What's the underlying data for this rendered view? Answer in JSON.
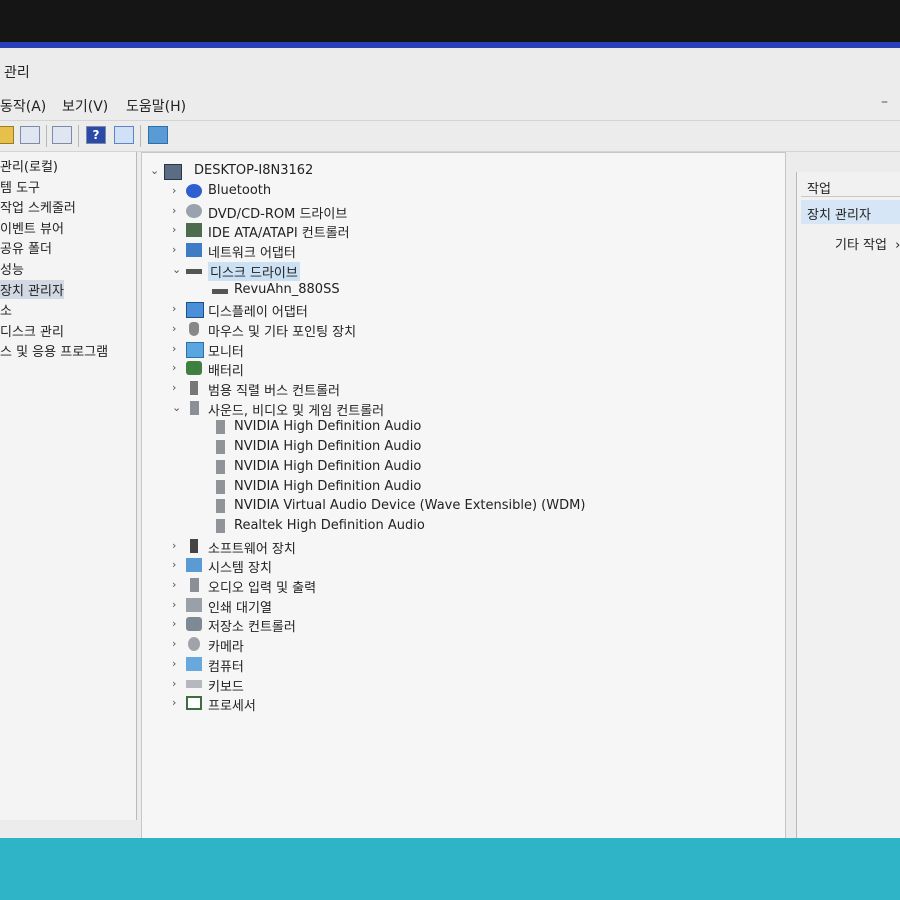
{
  "window": {
    "title": "관리"
  },
  "menu": {
    "items": [
      "동작(A)",
      "보기(V)",
      "도움말(H)"
    ],
    "minimize": "–"
  },
  "toolbar": {
    "help_glyph": "?"
  },
  "left_pane": {
    "items": [
      {
        "label": "관리(로컬)"
      },
      {
        "label": "템 도구"
      },
      {
        "label": "작업 스케줄러"
      },
      {
        "label": "이벤트 뷰어"
      },
      {
        "label": "공유 폴더"
      },
      {
        "label": "성능"
      },
      {
        "label": "장치 관리자",
        "selected": true
      },
      {
        "label": "소"
      },
      {
        "label": "디스크 관리"
      },
      {
        "label": "스 및 응용 프로그램"
      }
    ]
  },
  "tree": {
    "root": "DESKTOP-I8N3162",
    "nodes": [
      {
        "label": "Bluetooth",
        "depth": 1,
        "arrow": "›",
        "icon": "bluetooth-icon"
      },
      {
        "label": "DVD/CD-ROM 드라이브",
        "depth": 1,
        "arrow": "›",
        "icon": "dvd-drive-icon"
      },
      {
        "label": "IDE ATA/ATAPI 컨트롤러",
        "depth": 1,
        "arrow": "›",
        "icon": "ide-controller-icon"
      },
      {
        "label": "네트워크 어댑터",
        "depth": 1,
        "arrow": "›",
        "icon": "network-adapter-icon"
      },
      {
        "label": "디스크 드라이브",
        "depth": 1,
        "arrow": "⌄",
        "icon": "disk-drive-icon",
        "selected": true
      },
      {
        "label": "RevuAhn_880SS",
        "depth": 2,
        "arrow": "",
        "icon": "disk-drive-icon"
      },
      {
        "label": "디스플레이 어댑터",
        "depth": 1,
        "arrow": "›",
        "icon": "display-adapter-icon"
      },
      {
        "label": "마우스 및 기타 포인팅 장치",
        "depth": 1,
        "arrow": "›",
        "icon": "mouse-icon"
      },
      {
        "label": "모니터",
        "depth": 1,
        "arrow": "›",
        "icon": "monitor-icon"
      },
      {
        "label": "배터리",
        "depth": 1,
        "arrow": "›",
        "icon": "battery-icon"
      },
      {
        "label": "범용 직렬 버스 컨트롤러",
        "depth": 1,
        "arrow": "›",
        "icon": "usb-controller-icon"
      },
      {
        "label": "사운드, 비디오 및 게임 컨트롤러",
        "depth": 1,
        "arrow": "⌄",
        "icon": "sound-icon"
      },
      {
        "label": "NVIDIA High Definition Audio",
        "depth": 2,
        "arrow": "",
        "icon": "audio-device-icon"
      },
      {
        "label": "NVIDIA High Definition Audio",
        "depth": 2,
        "arrow": "",
        "icon": "audio-device-icon"
      },
      {
        "label": "NVIDIA High Definition Audio",
        "depth": 2,
        "arrow": "",
        "icon": "audio-device-icon"
      },
      {
        "label": "NVIDIA High Definition Audio",
        "depth": 2,
        "arrow": "",
        "icon": "audio-device-icon"
      },
      {
        "label": "NVIDIA Virtual Audio Device (Wave Extensible) (WDM)",
        "depth": 2,
        "arrow": "",
        "icon": "audio-device-icon"
      },
      {
        "label": "Realtek High Definition Audio",
        "depth": 2,
        "arrow": "",
        "icon": "audio-device-icon"
      },
      {
        "label": "소프트웨어 장치",
        "depth": 1,
        "arrow": "›",
        "icon": "software-device-icon"
      },
      {
        "label": "시스템 장치",
        "depth": 1,
        "arrow": "›",
        "icon": "system-device-icon"
      },
      {
        "label": "오디오 입력 및 출력",
        "depth": 1,
        "arrow": "›",
        "icon": "audio-io-icon"
      },
      {
        "label": "인쇄 대기열",
        "depth": 1,
        "arrow": "›",
        "icon": "print-queue-icon"
      },
      {
        "label": "저장소 컨트롤러",
        "depth": 1,
        "arrow": "›",
        "icon": "storage-controller-icon"
      },
      {
        "label": "카메라",
        "depth": 1,
        "arrow": "›",
        "icon": "camera-icon"
      },
      {
        "label": "컴퓨터",
        "depth": 1,
        "arrow": "›",
        "icon": "computer-icon"
      },
      {
        "label": "키보드",
        "depth": 1,
        "arrow": "›",
        "icon": "keyboard-icon"
      },
      {
        "label": "프로세서",
        "depth": 1,
        "arrow": "›",
        "icon": "processor-icon"
      }
    ]
  },
  "actions_pane": {
    "header": "작업",
    "section": "장치 관리자",
    "action": "기타 작업",
    "action_arrow": "›"
  }
}
